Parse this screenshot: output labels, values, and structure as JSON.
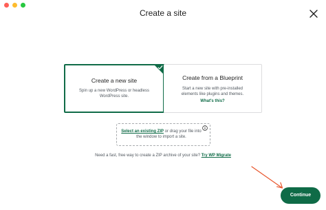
{
  "window": {
    "title": "Create a site"
  },
  "options": [
    {
      "title": "Create a new site",
      "description": "Spin up a new WordPress or headless WordPress site.",
      "selected": true
    },
    {
      "title": "Create from a Blueprint",
      "description": "Start a new site with pre-installed elements like plugins and themes.",
      "link": "What's this?",
      "selected": false
    }
  ],
  "import": {
    "link": "Select an existing ZIP",
    "text": "or drag your file into the window to import a site."
  },
  "migrate": {
    "text": "Need a fast, free way to create a ZIP archive of your site?",
    "link": "Try WP Migrate"
  },
  "actions": {
    "continue_label": "Continue"
  },
  "colors": {
    "accent": "#0f6b47",
    "annotation_arrow": "#e8552b"
  }
}
